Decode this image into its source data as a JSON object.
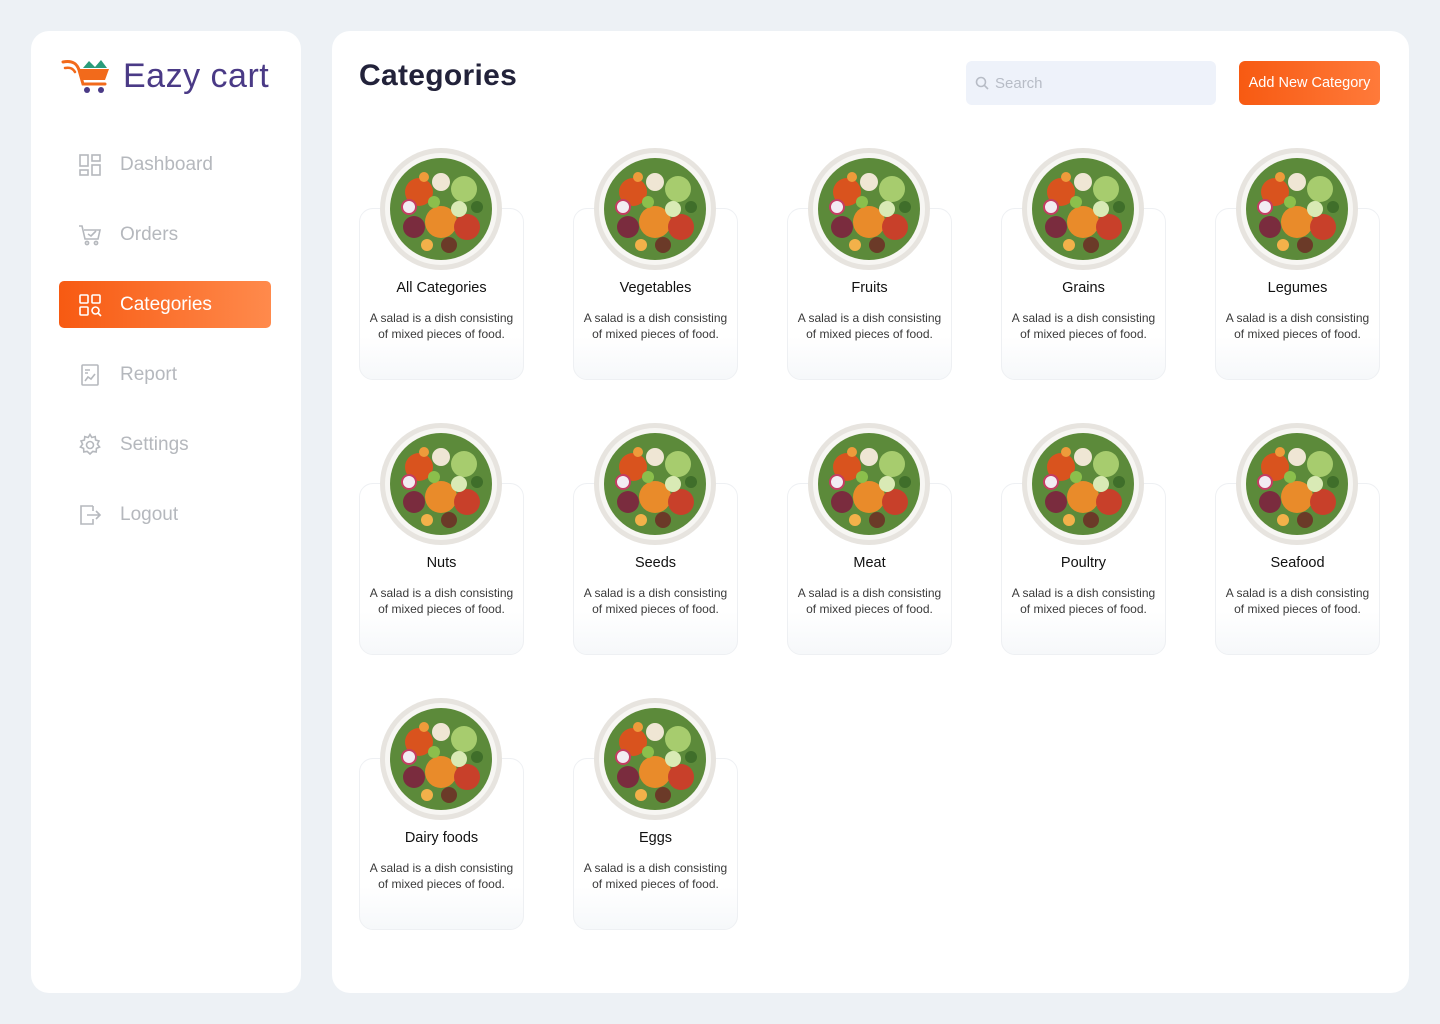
{
  "brand": {
    "name": "Eazy cart",
    "color": "#4a3a86",
    "accent": "#f75a12"
  },
  "sidebar": {
    "items": [
      {
        "label": "Dashboard",
        "icon": "dashboard-icon",
        "active": false
      },
      {
        "label": "Orders",
        "icon": "cart-icon",
        "active": false
      },
      {
        "label": "Categories",
        "icon": "categories-icon",
        "active": true
      },
      {
        "label": "Report",
        "icon": "report-icon",
        "active": false
      },
      {
        "label": "Settings",
        "icon": "gear-icon",
        "active": false
      },
      {
        "label": "Logout",
        "icon": "logout-icon",
        "active": false
      }
    ]
  },
  "header": {
    "title": "Categories",
    "search_placeholder": "Search",
    "add_button": "Add New Category"
  },
  "categories": [
    {
      "title": "All Categories",
      "desc": "A salad is a dish consisting of mixed pieces of food."
    },
    {
      "title": "Vegetables",
      "desc": "A salad is a dish consisting of mixed pieces of food."
    },
    {
      "title": "Fruits",
      "desc": "A salad is a dish consisting of mixed pieces of food."
    },
    {
      "title": "Grains",
      "desc": "A salad is a dish consisting of mixed pieces of food."
    },
    {
      "title": "Legumes",
      "desc": "A salad is a dish consisting of mixed pieces of food."
    },
    {
      "title": "Nuts",
      "desc": "A salad is a dish consisting of mixed pieces of food."
    },
    {
      "title": "Seeds",
      "desc": "A salad is a dish consisting of mixed pieces of food."
    },
    {
      "title": "Meat",
      "desc": "A salad is a dish consisting of mixed pieces of food."
    },
    {
      "title": "Poultry",
      "desc": "A salad is a dish consisting of mixed pieces of food."
    },
    {
      "title": "Seafood",
      "desc": "A salad is a dish consisting of mixed pieces of food."
    },
    {
      "title": "Dairy foods",
      "desc": "A salad is a dish consisting of mixed pieces of food."
    },
    {
      "title": "Eggs",
      "desc": "A salad is a dish consisting of mixed pieces of food."
    }
  ]
}
